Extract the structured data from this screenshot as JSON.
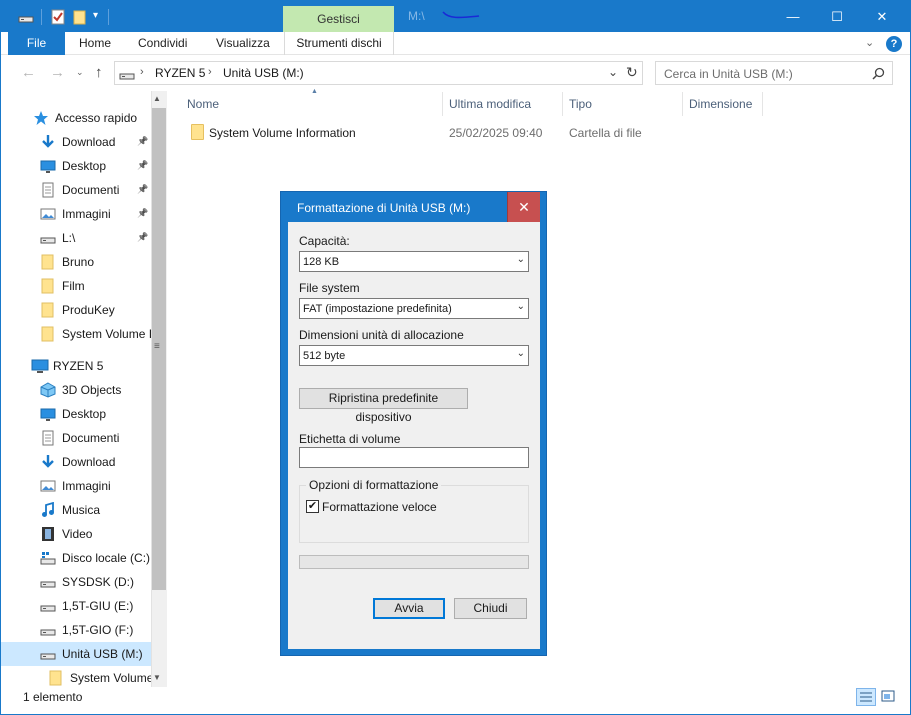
{
  "titlebar": {
    "context_tab": "Gestisci",
    "title": "M:\\",
    "minimize": "—",
    "maximize": "☐",
    "close": "✕"
  },
  "ribbon": {
    "tabs": [
      "File",
      "Home",
      "Condividi",
      "Visualizza",
      "Strumenti dischi"
    ],
    "help": "?"
  },
  "address": {
    "breadcrumb": [
      "RYZEN 5",
      "Unità USB (M:)"
    ],
    "search_placeholder": "Cerca in Unità USB (M:)"
  },
  "nav": {
    "quick_access": "Accesso rapido",
    "quick_items": [
      {
        "label": "Download",
        "icon": "download-arrow-icon",
        "pinned": true
      },
      {
        "label": "Desktop",
        "icon": "desktop-icon",
        "pinned": true
      },
      {
        "label": "Documenti",
        "icon": "document-icon",
        "pinned": true
      },
      {
        "label": "Immagini",
        "icon": "pictures-icon",
        "pinned": true
      },
      {
        "label": "L:\\",
        "icon": "drive-icon",
        "pinned": true
      },
      {
        "label": "Bruno",
        "icon": "folder-icon",
        "pinned": false
      },
      {
        "label": "Film",
        "icon": "folder-icon",
        "pinned": false
      },
      {
        "label": "ProduKey",
        "icon": "folder-icon",
        "pinned": false
      },
      {
        "label": "System Volume I",
        "icon": "folder-icon",
        "pinned": false
      }
    ],
    "this_pc": "RYZEN 5",
    "pc_items": [
      {
        "label": "3D Objects",
        "icon": "3d-objects-icon"
      },
      {
        "label": "Desktop",
        "icon": "desktop-icon"
      },
      {
        "label": "Documenti",
        "icon": "document-icon"
      },
      {
        "label": "Download",
        "icon": "download-arrow-icon"
      },
      {
        "label": "Immagini",
        "icon": "pictures-icon"
      },
      {
        "label": "Musica",
        "icon": "music-icon"
      },
      {
        "label": "Video",
        "icon": "video-icon"
      },
      {
        "label": "Disco locale (C:)",
        "icon": "windows-drive-icon"
      },
      {
        "label": "SYSDSK (D:)",
        "icon": "drive-icon"
      },
      {
        "label": "1,5T-GIU (E:)",
        "icon": "drive-icon"
      },
      {
        "label": "1,5T-GIO (F:)",
        "icon": "drive-icon"
      },
      {
        "label": "Unità USB (M:)",
        "icon": "usb-drive-icon"
      },
      {
        "label": "System Volume",
        "icon": "folder-icon"
      }
    ]
  },
  "filelist": {
    "columns": [
      "Nome",
      "Ultima modifica",
      "Tipo",
      "Dimensione"
    ],
    "rows": [
      {
        "name": "System Volume Information",
        "modified": "25/02/2025 09:40",
        "type": "Cartella di file",
        "size": ""
      }
    ]
  },
  "status": {
    "count": "1 elemento"
  },
  "dialog": {
    "title": "Formattazione di Unità USB (M:)",
    "close": "✕",
    "capacity_label": "Capacità:",
    "capacity_value": "128 KB",
    "fs_label": "File system",
    "fs_value": "FAT (impostazione predefinita)",
    "alloc_label": "Dimensioni unità di allocazione",
    "alloc_value": "512 byte",
    "restore_button": "Ripristina predefinite dispositivo",
    "volume_label": "Etichetta di volume",
    "volume_value": "",
    "options_legend": "Opzioni di formattazione",
    "quick_format_label": "Formattazione veloce",
    "quick_format_checked": true,
    "progress": 0,
    "start_button": "Avvia",
    "close_button": "Chiudi"
  },
  "colors": {
    "accent": "#1979ca",
    "context_tab": "#c3e8b0",
    "dialog_close": "#c75050",
    "selection": "#cce8ff"
  }
}
